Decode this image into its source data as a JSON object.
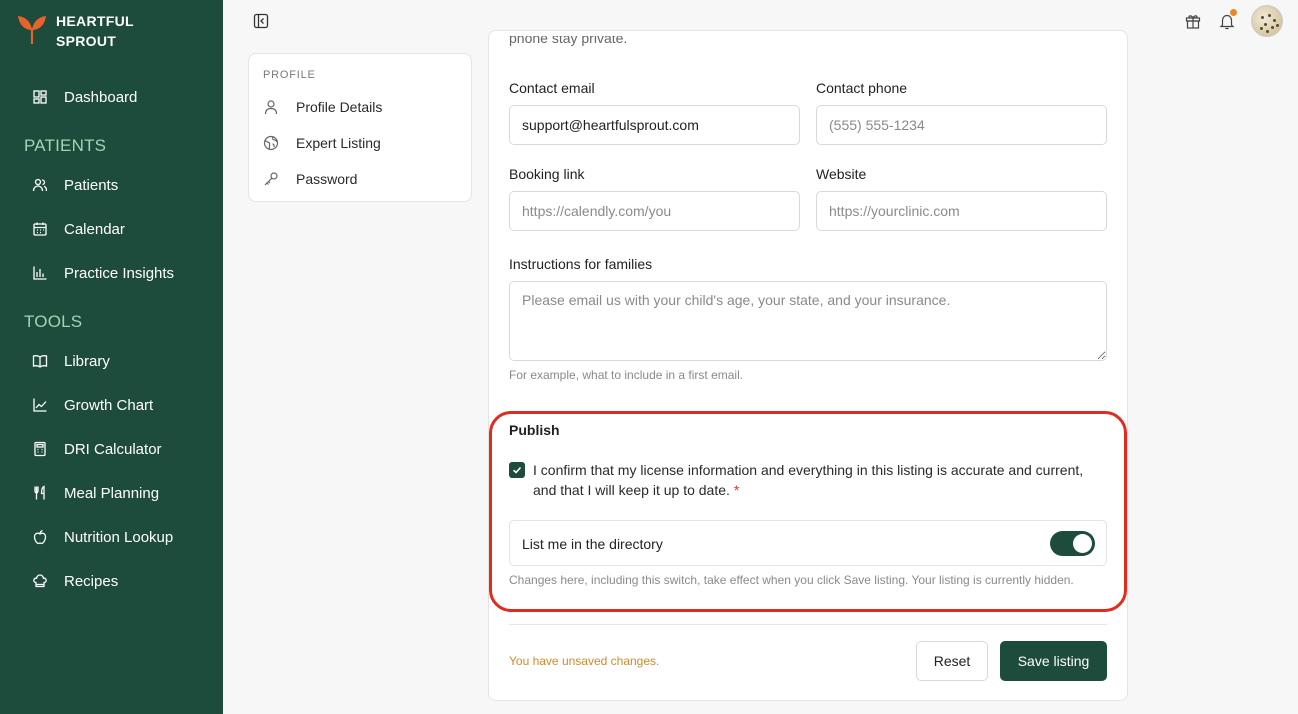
{
  "brand": {
    "line1": "HEARTFUL",
    "line2": "SPROUT"
  },
  "sidebar": {
    "dashboard": "Dashboard",
    "patients_section": "PATIENTS",
    "patients_items": [
      "Patients",
      "Calendar",
      "Practice Insights"
    ],
    "tools_section": "TOOLS",
    "tools_items": [
      "Library",
      "Growth Chart",
      "DRI Calculator",
      "Meal Planning",
      "Nutrition Lookup",
      "Recipes"
    ]
  },
  "profile_nav": {
    "header": "PROFILE",
    "items": [
      "Profile Details",
      "Expert Listing",
      "Password"
    ]
  },
  "form": {
    "clipped_text": "phone stay private.",
    "contact_email_label": "Contact email",
    "contact_email_value": "support@heartfulsprout.com",
    "contact_phone_label": "Contact phone",
    "contact_phone_placeholder": "(555) 555-1234",
    "booking_link_label": "Booking link",
    "booking_link_placeholder": "https://calendly.com/you",
    "website_label": "Website",
    "website_placeholder": "https://yourclinic.com",
    "instructions_label": "Instructions for families",
    "instructions_placeholder": "Please email us with your child's age, your state, and your insurance.",
    "instructions_hint": "For example, what to include in a first email."
  },
  "publish": {
    "title": "Publish",
    "confirm_text": "I confirm that my license information and everything in this listing is accurate and current, and that I will keep it up to date.",
    "required_mark": "*",
    "confirm_checked": true,
    "directory_label": "List me in the directory",
    "directory_on": true,
    "changes_note": "Changes here, including this switch, take effect when you click Save listing. Your listing is currently hidden."
  },
  "footer": {
    "unsaved": "You have unsaved changes.",
    "reset": "Reset",
    "save": "Save listing"
  },
  "colors": {
    "sidebar": "#1d4b3c",
    "accent": "#1d4b3c",
    "section_label": "#9fd7b5",
    "highlight": "#e02b20",
    "unsaved": "#d4882a",
    "notif_dot": "#e8892b"
  }
}
